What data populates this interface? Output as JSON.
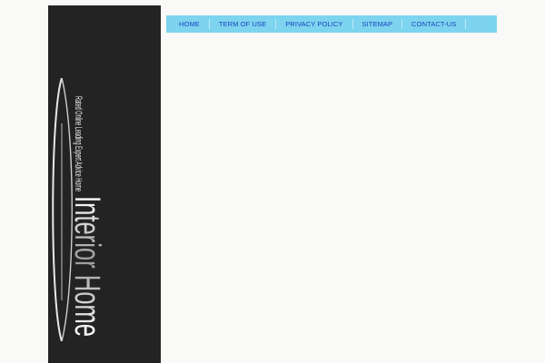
{
  "logo": {
    "text_top": "Rated Online Leading Expert Advice Home",
    "text_main": "Interior Home"
  },
  "nav": {
    "items": [
      {
        "label": "HOME"
      },
      {
        "label": "TERM OF USE"
      },
      {
        "label": "PRIVACY POLICY"
      },
      {
        "label": "SITEMAP"
      },
      {
        "label": "CONTACT-US"
      }
    ]
  },
  "colors": {
    "sidebar_bg": "#232323",
    "nav_bg": "#7dd4ee",
    "nav_text": "#1a3fc0",
    "page_bg": "#f9f9f7"
  }
}
